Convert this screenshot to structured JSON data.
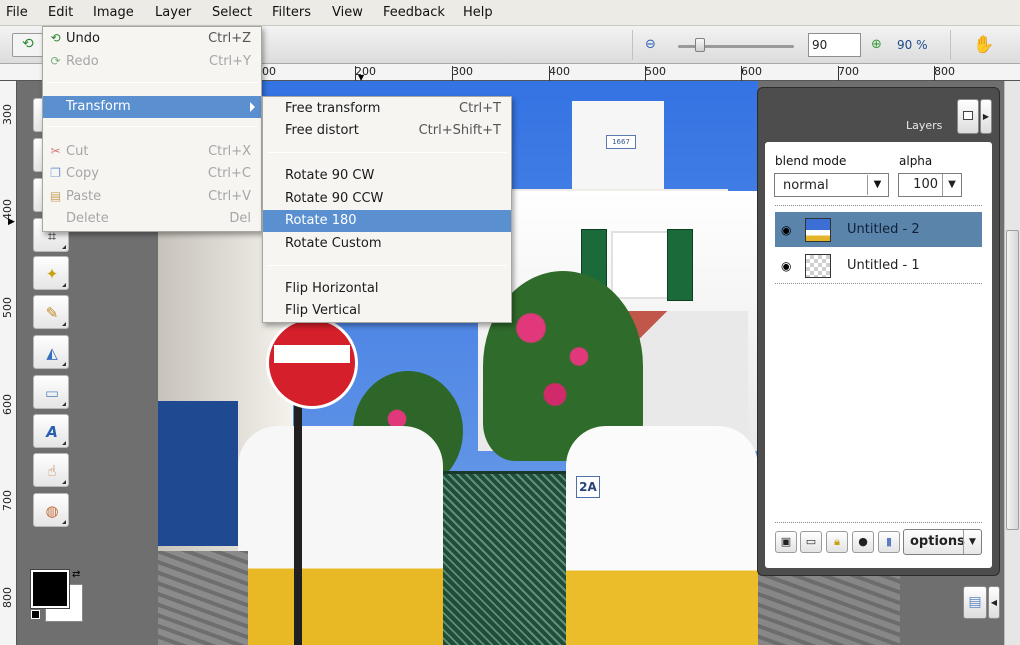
{
  "menubar": {
    "items": [
      "File",
      "Edit",
      "Image",
      "Layer",
      "Select",
      "Filters",
      "View",
      "Feedback",
      "Help"
    ]
  },
  "toolbar": {
    "zoom_value": "90",
    "zoom_percent": "90 %",
    "icons": [
      "undo-icon",
      "zoom-out-icon",
      "zoom-in-icon",
      "hand-icon"
    ]
  },
  "rulers": {
    "top": [
      "00",
      "200",
      "300",
      "400",
      "500",
      "600",
      "700",
      "800"
    ],
    "left": [
      "300",
      "400",
      "500",
      "600",
      "700",
      "800"
    ]
  },
  "tools": {
    "icons": [
      "move-icon",
      "marquee-icon",
      "lasso-icon",
      "crop-icon",
      "magic-wand-icon",
      "pencil-icon",
      "paint-bucket-icon",
      "rectangle-icon",
      "text-icon",
      "smudge-icon",
      "color-picker-icon"
    ],
    "foreground_color": "#000000",
    "background_color": "#ffffff"
  },
  "photo": {
    "house_number": "2A",
    "tower_sign": "1667"
  },
  "edit_menu": {
    "items": [
      {
        "label": "Undo",
        "shortcut": "Ctrl+Z",
        "enabled": true,
        "icon": "undo-icon"
      },
      {
        "label": "Redo",
        "shortcut": "Ctrl+Y",
        "enabled": false,
        "icon": "redo-icon"
      },
      {
        "label": "Transform",
        "shortcut": "",
        "enabled": true,
        "submenu": true
      },
      {
        "label": "Cut",
        "shortcut": "Ctrl+X",
        "enabled": false,
        "icon": "scissors-icon"
      },
      {
        "label": "Copy",
        "shortcut": "Ctrl+C",
        "enabled": false,
        "icon": "copy-icon"
      },
      {
        "label": "Paste",
        "shortcut": "Ctrl+V",
        "enabled": false,
        "icon": "paste-icon"
      },
      {
        "label": "Delete",
        "shortcut": "Del",
        "enabled": false
      }
    ]
  },
  "transform_menu": {
    "items": [
      {
        "label": "Free transform",
        "shortcut": "Ctrl+T"
      },
      {
        "label": "Free distort",
        "shortcut": "Ctrl+Shift+T"
      },
      {
        "label": "Rotate 90 CW",
        "shortcut": ""
      },
      {
        "label": "Rotate 90 CCW",
        "shortcut": ""
      },
      {
        "label": "Rotate 180",
        "shortcut": ""
      },
      {
        "label": "Rotate Custom",
        "shortcut": ""
      },
      {
        "label": "Flip Horizontal",
        "shortcut": ""
      },
      {
        "label": "Flip Vertical",
        "shortcut": ""
      }
    ],
    "highlighted": "Rotate 180"
  },
  "layers": {
    "title": "Layers",
    "blend_mode_label": "blend mode",
    "blend_mode_value": "normal",
    "alpha_label": "alpha",
    "alpha_value": "100",
    "rows": [
      {
        "name": "Untitled - 2",
        "selected": true
      },
      {
        "name": "Untitled - 1",
        "selected": false
      }
    ],
    "options_label": "options",
    "colors": {
      "selected_row": "#5a84a9",
      "panel": "#4d4d4d"
    }
  },
  "colors": {
    "menu_highlight": "#5a8fd0",
    "accent": "#204a87"
  }
}
